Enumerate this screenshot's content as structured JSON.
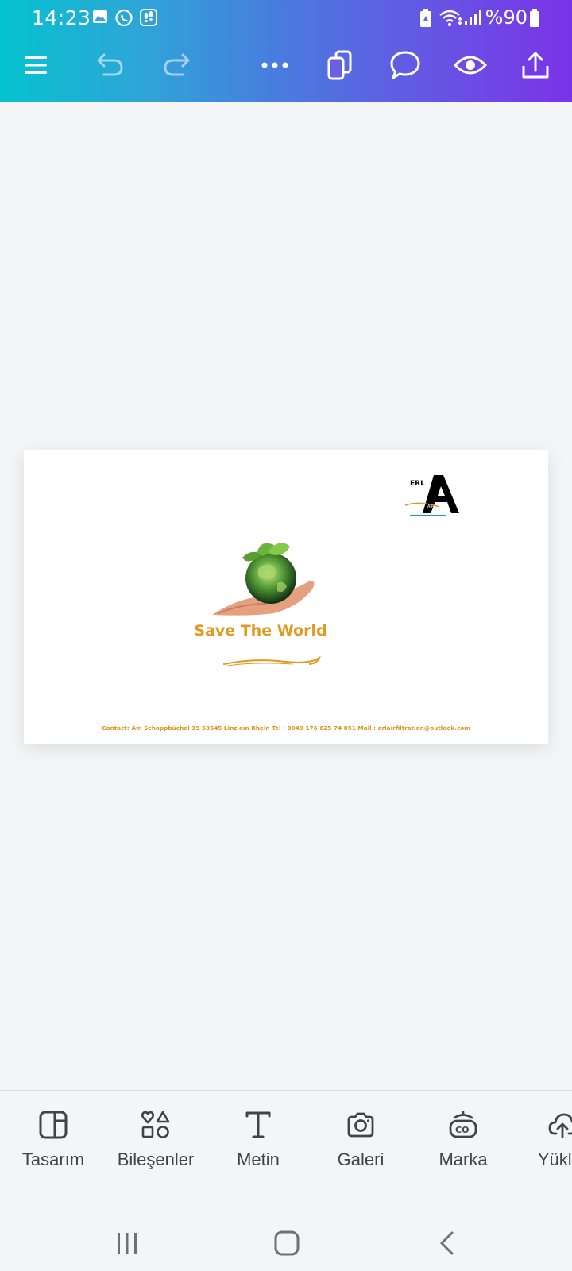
{
  "status_bar": {
    "time": "14:23",
    "battery_text": "%90",
    "left_icons": [
      "gallery-icon",
      "whatsapp-icon",
      "footsteps-icon"
    ],
    "right_icons": [
      "battery-saver-icon",
      "wifi-icon",
      "signal-icon",
      "battery-icon"
    ]
  },
  "toolbar": {
    "items": [
      "menu-icon",
      "undo-icon",
      "redo-icon",
      "more-icon",
      "pages-icon",
      "comment-icon",
      "preview-icon",
      "share-icon"
    ]
  },
  "design": {
    "logo_letters": "ERL",
    "logo_sub": "AIR FILTER",
    "title": "Save The World",
    "contact": "Contact: Am Schoppbüchel 19 53545 Linz am Rhein    Tel : 0049 176 625 74 851  Mail : erlairfiltration@outlook.com",
    "accent_color": "#e29a1e"
  },
  "bottom_tools": [
    {
      "label": "Tasarım",
      "icon": "design-icon"
    },
    {
      "label": "Bileşenler",
      "icon": "elements-icon"
    },
    {
      "label": "Metin",
      "icon": "text-icon"
    },
    {
      "label": "Galeri",
      "icon": "camera-icon"
    },
    {
      "label": "Marka",
      "icon": "brand-icon"
    },
    {
      "label": "Yükler",
      "icon": "upload-icon"
    }
  ],
  "nav_bar": [
    "recents-icon",
    "home-icon",
    "back-icon"
  ]
}
